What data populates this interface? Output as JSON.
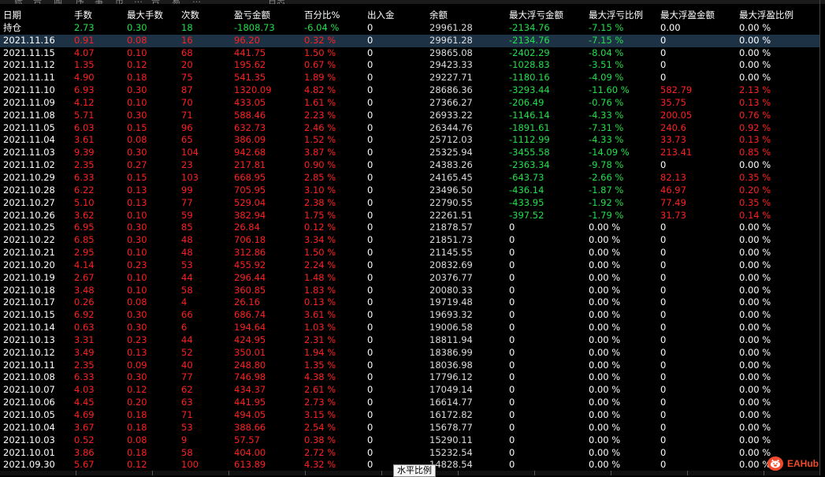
{
  "top_tabs": [
    "账",
    "告",
    "闻",
    "序",
    "事",
    "市",
    "…",
    "告",
    "易",
    "…",
    "日志"
  ],
  "columns": [
    "日期",
    "手数",
    "最大手数",
    "次数",
    "盈亏金额",
    "百分比%",
    "出入金",
    "余额",
    "最大浮亏金额",
    "最大浮亏比例",
    "最大浮盈金额",
    "最大浮盈比例"
  ],
  "holding": [
    "持仓",
    "2.73",
    "0.30",
    "18",
    "-1808.73",
    "-6.04 %",
    "0",
    "29961.28",
    "-2134.76",
    "-7.15 %",
    "0.00",
    "0.00 %"
  ],
  "rows": [
    [
      "2021.11.16",
      "0.91",
      "0.08",
      "16",
      "96.20",
      "0.32 %",
      "0",
      "29961.28",
      "-2134.76",
      "-7.15 %",
      "0",
      "0.00 %"
    ],
    [
      "2021.11.15",
      "4.07",
      "0.10",
      "68",
      "441.75",
      "1.50 %",
      "0",
      "29865.08",
      "-2402.29",
      "-8.04 %",
      "0",
      "0.00 %"
    ],
    [
      "2021.11.12",
      "1.35",
      "0.12",
      "20",
      "195.62",
      "0.67 %",
      "0",
      "29423.33",
      "-1028.83",
      "-3.51 %",
      "0",
      "0.00 %"
    ],
    [
      "2021.11.11",
      "4.90",
      "0.18",
      "75",
      "541.35",
      "1.89 %",
      "0",
      "29227.71",
      "-1180.16",
      "-4.09 %",
      "0",
      "0.00 %"
    ],
    [
      "2021.11.10",
      "6.93",
      "0.30",
      "87",
      "1320.09",
      "4.82 %",
      "0",
      "28686.36",
      "-3293.44",
      "-11.60 %",
      "582.79",
      "2.13 %"
    ],
    [
      "2021.11.09",
      "4.12",
      "0.10",
      "70",
      "433.05",
      "1.61 %",
      "0",
      "27366.27",
      "-206.49",
      "-0.76 %",
      "35.75",
      "0.13 %"
    ],
    [
      "2021.11.08",
      "5.71",
      "0.30",
      "71",
      "588.46",
      "2.23 %",
      "0",
      "26933.22",
      "-1146.14",
      "-4.33 %",
      "200.05",
      "0.76 %"
    ],
    [
      "2021.11.05",
      "6.03",
      "0.15",
      "96",
      "632.73",
      "2.46 %",
      "0",
      "26344.76",
      "-1891.61",
      "-7.31 %",
      "240.6",
      "0.92 %"
    ],
    [
      "2021.11.04",
      "3.61",
      "0.08",
      "65",
      "386.09",
      "1.52 %",
      "0",
      "25712.03",
      "-1112.99",
      "-4.33 %",
      "33.73",
      "0.13 %"
    ],
    [
      "2021.11.03",
      "9.39",
      "0.30",
      "104",
      "942.68",
      "3.87 %",
      "0",
      "25325.94",
      "-3455.58",
      "-14.09 %",
      "213.41",
      "0.85 %"
    ],
    [
      "2021.11.02",
      "2.35",
      "0.27",
      "23",
      "217.81",
      "0.90 %",
      "0",
      "24383.26",
      "-2363.34",
      "-9.78 %",
      "0",
      "0.00 %"
    ],
    [
      "2021.10.29",
      "6.33",
      "0.15",
      "103",
      "668.95",
      "2.85 %",
      "0",
      "24165.45",
      "-643.73",
      "-2.66 %",
      "82.13",
      "0.35 %"
    ],
    [
      "2021.10.28",
      "6.22",
      "0.13",
      "99",
      "705.95",
      "3.10 %",
      "0",
      "23496.50",
      "-436.14",
      "-1.87 %",
      "46.97",
      "0.20 %"
    ],
    [
      "2021.10.27",
      "5.10",
      "0.13",
      "77",
      "529.04",
      "2.38 %",
      "0",
      "22790.55",
      "-433.95",
      "-1.92 %",
      "77.49",
      "0.35 %"
    ],
    [
      "2021.10.26",
      "3.62",
      "0.10",
      "59",
      "382.94",
      "1.75 %",
      "0",
      "22261.51",
      "-397.52",
      "-1.79 %",
      "31.73",
      "0.14 %"
    ],
    [
      "2021.10.25",
      "6.95",
      "0.30",
      "85",
      "26.84",
      "0.12 %",
      "0",
      "21878.57",
      "0",
      "0.00 %",
      "0",
      "0.00 %"
    ],
    [
      "2021.10.22",
      "6.85",
      "0.30",
      "48",
      "706.18",
      "3.34 %",
      "0",
      "21851.73",
      "0",
      "0.00 %",
      "0",
      "0.00 %"
    ],
    [
      "2021.10.21",
      "2.95",
      "0.10",
      "48",
      "312.86",
      "1.50 %",
      "0",
      "21145.55",
      "0",
      "0.00 %",
      "0",
      "0.00 %"
    ],
    [
      "2021.10.20",
      "4.14",
      "0.23",
      "53",
      "455.92",
      "2.24 %",
      "0",
      "20832.69",
      "0",
      "0.00 %",
      "0",
      "0.00 %"
    ],
    [
      "2021.10.19",
      "2.67",
      "0.10",
      "44",
      "296.44",
      "1.48 %",
      "0",
      "20376.77",
      "0",
      "0.00 %",
      "0",
      "0.00 %"
    ],
    [
      "2021.10.18",
      "3.48",
      "0.10",
      "58",
      "360.85",
      "1.83 %",
      "0",
      "20080.33",
      "0",
      "0.00 %",
      "0",
      "0.00 %"
    ],
    [
      "2021.10.17",
      "0.26",
      "0.08",
      "4",
      "26.16",
      "0.13 %",
      "0",
      "19719.48",
      "0",
      "0.00 %",
      "0",
      "0.00 %"
    ],
    [
      "2021.10.15",
      "6.92",
      "0.30",
      "66",
      "686.74",
      "3.61 %",
      "0",
      "19693.32",
      "0",
      "0.00 %",
      "0",
      "0.00 %"
    ],
    [
      "2021.10.14",
      "0.63",
      "0.30",
      "6",
      "194.64",
      "1.03 %",
      "0",
      "19006.58",
      "0",
      "0.00 %",
      "0",
      "0.00 %"
    ],
    [
      "2021.10.13",
      "3.31",
      "0.23",
      "44",
      "424.95",
      "2.31 %",
      "0",
      "18811.94",
      "0",
      "0.00 %",
      "0",
      "0.00 %"
    ],
    [
      "2021.10.12",
      "3.49",
      "0.13",
      "52",
      "350.01",
      "1.94 %",
      "0",
      "18386.99",
      "0",
      "0.00 %",
      "0",
      "0.00 %"
    ],
    [
      "2021.10.11",
      "2.35",
      "0.09",
      "40",
      "248.80",
      "1.35 %",
      "0",
      "18036.98",
      "0",
      "0.00 %",
      "0",
      "0.00 %"
    ],
    [
      "2021.10.08",
      "6.33",
      "0.30",
      "77",
      "746.98",
      "4.38 %",
      "0",
      "17796.12",
      "0",
      "0.00 %",
      "0",
      "0.00 %"
    ],
    [
      "2021.10.07",
      "4.03",
      "0.12",
      "62",
      "434.37",
      "2.61 %",
      "0",
      "17049.14",
      "0",
      "0.00 %",
      "0",
      "0.00 %"
    ],
    [
      "2021.10.06",
      "4.45",
      "0.20",
      "63",
      "441.95",
      "2.73 %",
      "0",
      "16614.77",
      "0",
      "0.00 %",
      "0",
      "0.00 %"
    ],
    [
      "2021.10.05",
      "4.69",
      "0.18",
      "71",
      "494.05",
      "3.15 %",
      "0",
      "16172.82",
      "0",
      "0.00 %",
      "0",
      "0.00 %"
    ],
    [
      "2021.10.04",
      "3.67",
      "0.18",
      "53",
      "388.66",
      "2.54 %",
      "0",
      "15678.77",
      "0",
      "0.00 %",
      "0",
      "0.00 %"
    ],
    [
      "2021.10.03",
      "0.52",
      "0.08",
      "9",
      "57.57",
      "0.38 %",
      "0",
      "15290.11",
      "0",
      "0.00 %",
      "0",
      "0.00 %"
    ],
    [
      "2021.10.01",
      "3.86",
      "0.18",
      "58",
      "404.00",
      "2.72 %",
      "0",
      "15232.54",
      "0",
      "0.00 %",
      "0",
      "0.00 %"
    ],
    [
      "2021.09.30",
      "5.67",
      "0.12",
      "100",
      "613.89",
      "4.32 %",
      "0",
      "14828.54",
      "0",
      "0.00 %",
      "0",
      "0.00 %"
    ]
  ],
  "tooltip": "水平比例",
  "logo_text": "EAHub",
  "colors": {
    "positive": "#ff2020",
    "negative": "#22e04a",
    "text": "#ffffff",
    "background": "#000000",
    "selected_row": "#1e3246"
  }
}
